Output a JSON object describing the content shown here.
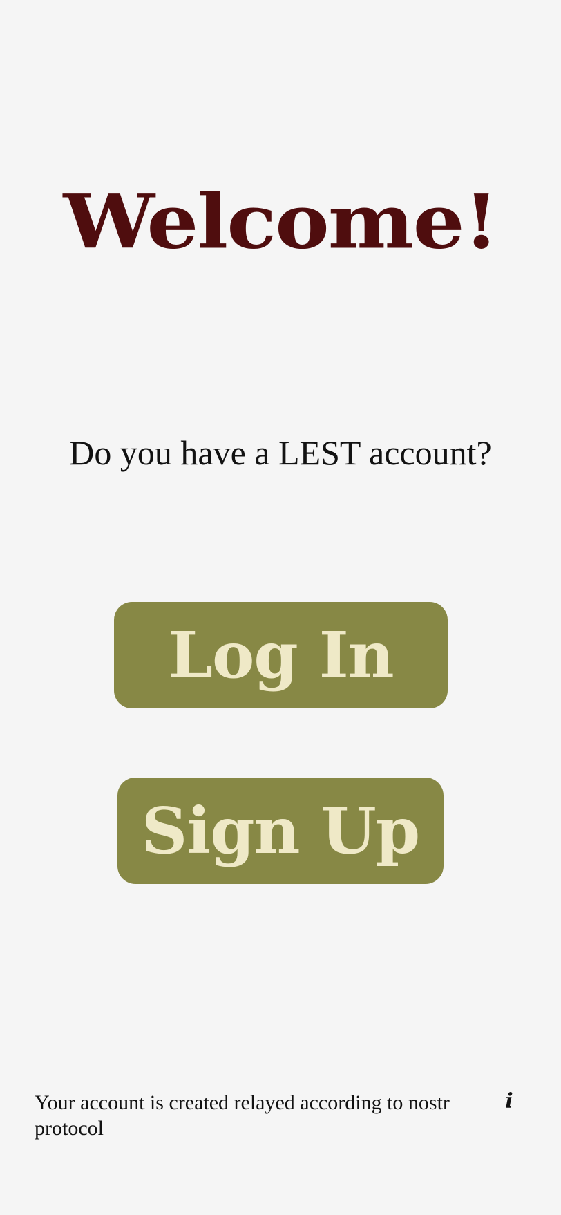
{
  "header": {
    "title": "Welcome!"
  },
  "main": {
    "question": "Do you have a LEST account?",
    "login_label": "Log In",
    "signup_label": "Sign Up"
  },
  "footer": {
    "note": "Your account is created relayed according to nostr protocol",
    "info_icon": "info-icon",
    "info_glyph": "i"
  },
  "colors": {
    "background": "#f5f5f5",
    "title": "#4f0d0e",
    "button": "#878845",
    "button_text": "#efe9c7",
    "text": "#121212"
  }
}
